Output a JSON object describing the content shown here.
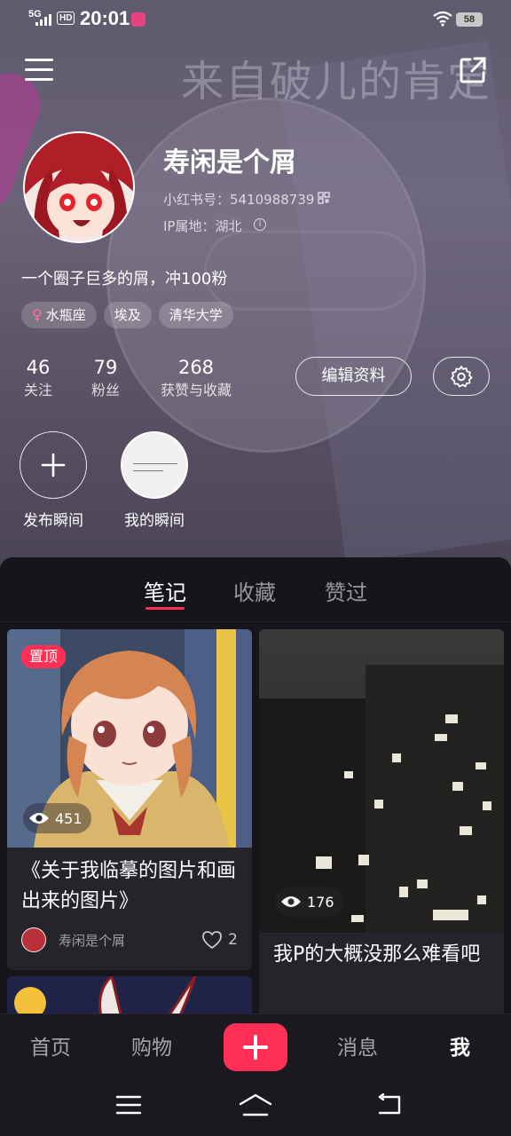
{
  "status_bar": {
    "network": "5G",
    "hd": "HD",
    "time": "20:01",
    "battery": "58"
  },
  "header": {
    "background_text": "来自破儿的肯定"
  },
  "profile": {
    "username": "寿闲是个屑",
    "user_id": "小红书号：5410988739",
    "ip_location": "IP属地：湖北",
    "bio": "一个圈子巨多的屑，冲100粉",
    "tags": [
      {
        "label": "水瓶座",
        "icon": "female-icon"
      },
      {
        "label": "埃及"
      },
      {
        "label": "清华大学"
      }
    ],
    "stats": {
      "following": {
        "value": "46",
        "label": "关注"
      },
      "followers": {
        "value": "79",
        "label": "粉丝"
      },
      "likes": {
        "value": "268",
        "label": "获赞与收藏"
      }
    },
    "edit_label": "编辑资料"
  },
  "moments": {
    "publish_label": "发布瞬间",
    "mine_label": "我的瞬间"
  },
  "tabs": [
    {
      "label": "笔记",
      "active": true
    },
    {
      "label": "收藏",
      "active": false
    },
    {
      "label": "赞过",
      "active": false
    }
  ],
  "notes": [
    {
      "pinned_label": "置顶",
      "views": "451",
      "title": "《关于我临摹的图片和画出来的图片》",
      "author": "寿闲是个屑",
      "likes": "2"
    },
    {
      "views": "176",
      "title": "我P的大概没那么难看吧"
    }
  ],
  "bottom_nav": {
    "home": "首页",
    "shop": "购物",
    "messages": "消息",
    "me": "我"
  },
  "colors": {
    "accent": "#ff2f55",
    "background": "#16151b"
  }
}
